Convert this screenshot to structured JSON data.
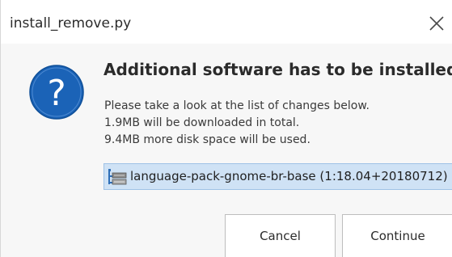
{
  "window": {
    "title": "install_remove.py"
  },
  "dialog": {
    "heading": "Additional software has to be installed",
    "message_lines": [
      "Please take a look at the list of changes below.",
      "1.9MB will be downloaded in total.",
      "9.4MB more disk space will be used."
    ],
    "changes": [
      {
        "icon": "package-icon",
        "label": "language-pack-gnome-br-base (1:18.04+20180712)",
        "selected": true
      }
    ]
  },
  "buttons": {
    "cancel_label": "Cancel",
    "continue_label": "Continue"
  },
  "icons": {
    "close": "close-icon",
    "dialog": "question-icon"
  },
  "colors": {
    "question_icon_fill": "#1b63b7",
    "selection_background": "#cfe2f5",
    "selection_border": "#9fc2e6"
  }
}
